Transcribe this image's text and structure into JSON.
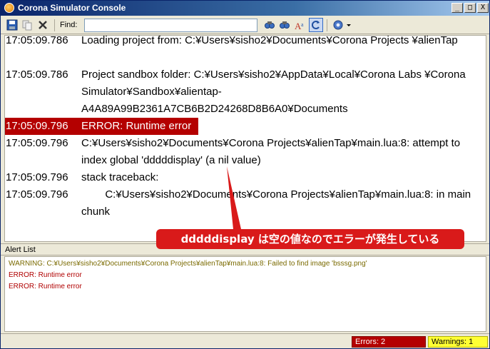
{
  "window": {
    "title": "Corona Simulator Console",
    "minimize_glyph": "_",
    "maximize_glyph": "□",
    "close_glyph": "X"
  },
  "toolbar": {
    "find_label": "Find:",
    "find_value": "",
    "icons": [
      "save-icon",
      "copy-icon",
      "clear-icon",
      "find-next-icon",
      "find-previous-icon",
      "match-case-icon",
      "wrap-icon",
      "settings-icon",
      "dropdown-arrow-icon"
    ]
  },
  "console": {
    "rows": [
      {
        "time": "17:05:09.786",
        "message": "Loading project from:   C:¥Users¥sisho2¥Documents¥Corona Projects ¥alienTap",
        "type": "normal"
      },
      {
        "time": "17:05:09.786",
        "message": "Project sandbox folder: C:¥Users¥sisho2¥AppData¥Local¥Corona Labs ¥Corona Simulator¥Sandbox¥alientap- A4A89A99B2361A7CB6B2D24268D8B6A0¥Documents",
        "type": "normal"
      },
      {
        "time": "17:05:09.796",
        "message": "ERROR: Runtime error",
        "type": "error"
      },
      {
        "time": "17:05:09.796",
        "message": "C:¥Users¥sisho2¥Documents¥Corona Projects¥alienTap¥main.lua:8: attempt to index global 'dddddisplay' (a nil value)",
        "type": "normal"
      },
      {
        "time": "17:05:09.796",
        "message": "stack traceback:",
        "type": "normal"
      },
      {
        "time": "17:05:09.796",
        "message": "        C:¥Users¥sisho2¥Documents¥Corona Projects¥alienTap¥main.lua:8: in main chunk",
        "type": "normal"
      }
    ]
  },
  "alerts": {
    "header": "Alert List",
    "items": [
      {
        "text": "WARNING: C:¥Users¥sisho2¥Documents¥Corona Projects¥alienTap¥main.lua:8: Failed to find image 'bsssg.png'",
        "type": "warning"
      },
      {
        "text": "ERROR: Runtime error",
        "type": "error"
      },
      {
        "text": "ERROR: Runtime error",
        "type": "error"
      }
    ]
  },
  "status": {
    "errors": "Errors: 2",
    "warnings": "Warnings: 1"
  },
  "annotation": {
    "text": "dddddisplay は空の値なのでエラーが発生している",
    "color": "#d91a1a"
  },
  "colors": {
    "error_highlight": "#b40000",
    "warning_badge": "#ffff33",
    "title_bar": "#0a246a"
  }
}
